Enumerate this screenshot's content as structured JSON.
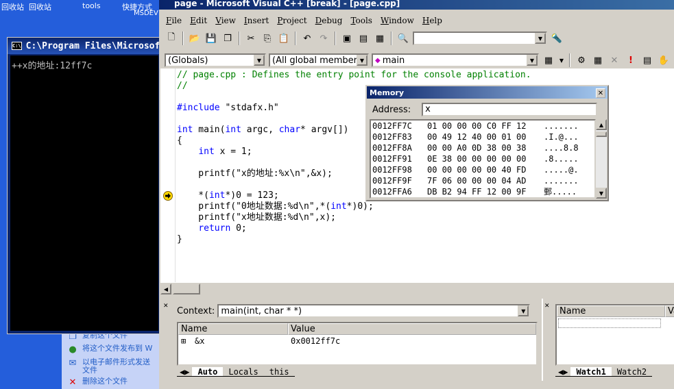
{
  "desktop": {
    "icon_recycle_bin": "回收站",
    "icon_tools": "tools",
    "icon_shortcut": "快捷方式",
    "icon_msdev": "MSDEV",
    "panel_items": [
      "复制这个文件",
      "将这个文件发布到 W",
      "以电子邮件形式发送",
      "文件",
      "删除这个文件"
    ]
  },
  "console": {
    "title": "C:\\Program Files\\Microsoft",
    "output": "++x的地址:12ff7c"
  },
  "vc": {
    "title": "page - Microsoft Visual C++ [break] - [page.cpp]",
    "menu": [
      {
        "key": "F",
        "rest": "ile"
      },
      {
        "key": "E",
        "rest": "dit"
      },
      {
        "key": "V",
        "rest": "iew"
      },
      {
        "key": "I",
        "rest": "nsert"
      },
      {
        "key": "P",
        "rest": "roject"
      },
      {
        "key": "D",
        "rest": "ebug"
      },
      {
        "key": "T",
        "rest": "ools"
      },
      {
        "key": "W",
        "rest": "indow"
      },
      {
        "key": "H",
        "rest": "elp"
      }
    ],
    "combo_find": "",
    "combo_globals": "(Globals)",
    "combo_members": "(All global members",
    "combo_function": "main"
  },
  "code": {
    "line1": "// page.cpp : Defines the entry point for the console application.",
    "line2": "//",
    "line4a": "#include",
    "line4b": " \"stdafx.h\"",
    "line6": "int main(int argc, char* argv[])",
    "line7": "{",
    "line8": "    int x = 1;",
    "line10": "    printf(\"x的地址:%x\\n\",&x);",
    "line12": "    *(int*)0 = 123;",
    "line13": "    printf(\"0地址数据:%d\\n\",*(int*)0);",
    "line14": "    printf(\"x地址数据:%d\\n\",x);",
    "line15": "    return 0;",
    "line16": "}"
  },
  "memory": {
    "title": "Memory",
    "address_label": "Address:",
    "address_value": "x",
    "rows": [
      {
        "addr": "0012FF7C",
        "bytes": "01 00 00 00 C0 FF 12",
        "ascii": "......."
      },
      {
        "addr": "0012FF83",
        "bytes": "00 49 12 40 00 01 00",
        "ascii": ".I.@..."
      },
      {
        "addr": "0012FF8A",
        "bytes": "00 00 A0 0D 38 00 38",
        "ascii": "....8.8"
      },
      {
        "addr": "0012FF91",
        "bytes": "0E 38 00 00 00 00 00",
        "ascii": ".8....."
      },
      {
        "addr": "0012FF98",
        "bytes": "00 00 00 00 00 40 FD",
        "ascii": ".....@."
      },
      {
        "addr": "0012FF9F",
        "bytes": "7F 06 00 00 00 04 AD",
        "ascii": "......."
      },
      {
        "addr": "0012FFA6",
        "bytes": "DB B2 94 FF 12 00 9F",
        "ascii": "鄄....."
      }
    ]
  },
  "variables": {
    "context_label": "Context:",
    "context_value": "main(int, char * *)",
    "col_name": "Name",
    "col_value": "Value",
    "row_name": "&x",
    "row_value": "0x0012ff7c",
    "tabs": [
      "Auto",
      "Locals",
      "this"
    ]
  },
  "watch": {
    "col_name": "Name",
    "col_value": "Va",
    "tabs": [
      "Watch1",
      "Watch2"
    ]
  }
}
